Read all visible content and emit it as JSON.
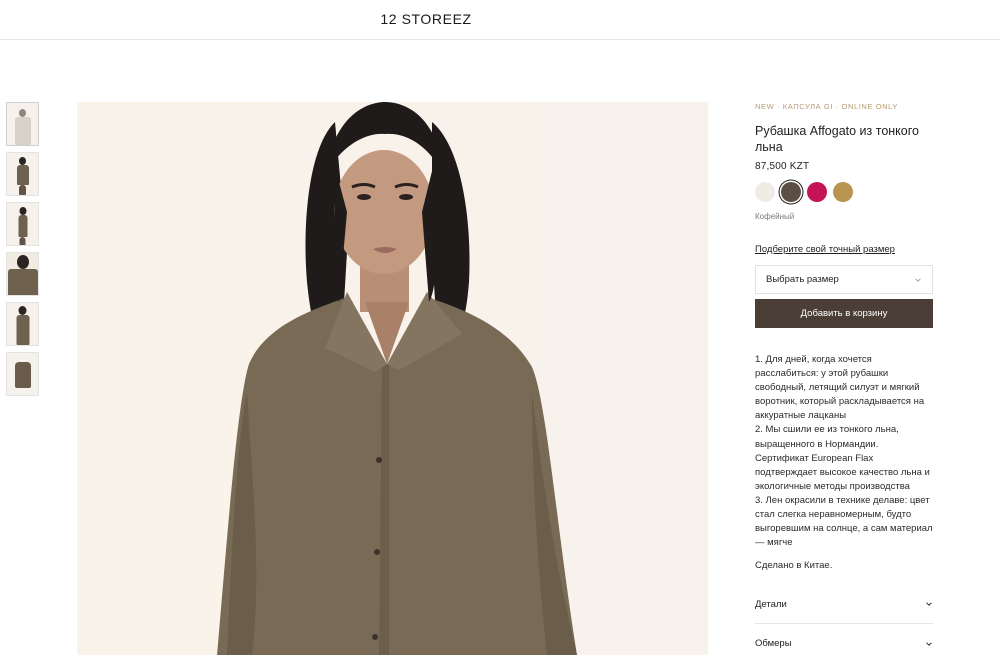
{
  "header": {
    "logo": "12 STOREEZ"
  },
  "gallery": {
    "thumbnails": [
      {
        "name": "thumb-1",
        "active": true
      },
      {
        "name": "thumb-2",
        "active": false
      },
      {
        "name": "thumb-3",
        "active": false
      },
      {
        "name": "thumb-4",
        "active": false
      },
      {
        "name": "thumb-5",
        "active": false
      },
      {
        "name": "thumb-6",
        "active": false
      }
    ]
  },
  "product": {
    "tagline": "NEW · КАПСУЛА GI · ONLINE ONLY",
    "title": "Рубашка Affogato из тонкого льна",
    "price": "87,500 KZT",
    "swatches": [
      {
        "color": "#efece6",
        "selected": false
      },
      {
        "color": "#5b4f44",
        "selected": true
      },
      {
        "color": "#c41455",
        "selected": false
      },
      {
        "color": "#b89650",
        "selected": false
      }
    ],
    "color_name": "Кофейный",
    "size_link": "Подберите свой точный размер",
    "size_select": "Выбрать размер",
    "add_to_cart": "Добавить в корзину",
    "description": [
      "1. Для дней, когда хочется расслабиться: у этой рубашки свободный, летящий силуэт и мягкий воротник, который раскладывается на аккуратные лацканы",
      "2. Мы сшили ее из тонкого льна, выращенного в Нормандии. Сертификат European Flax подтверждает высокое качество льна и экологичные методы производства",
      "3. Лен окрасили в технике делаве: цвет стал слегка неравномерным, будто выгоревшим на солнце, а сам материал — мягче"
    ],
    "origin": "Сделано в Китае.",
    "accordion": [
      "Детали",
      "Обмеры"
    ]
  },
  "colors": {
    "button_bg": "#4a3e36",
    "accent_tag": "#b89a74",
    "photo_bg": "#f9f3ec",
    "shirt": "#786a54"
  }
}
